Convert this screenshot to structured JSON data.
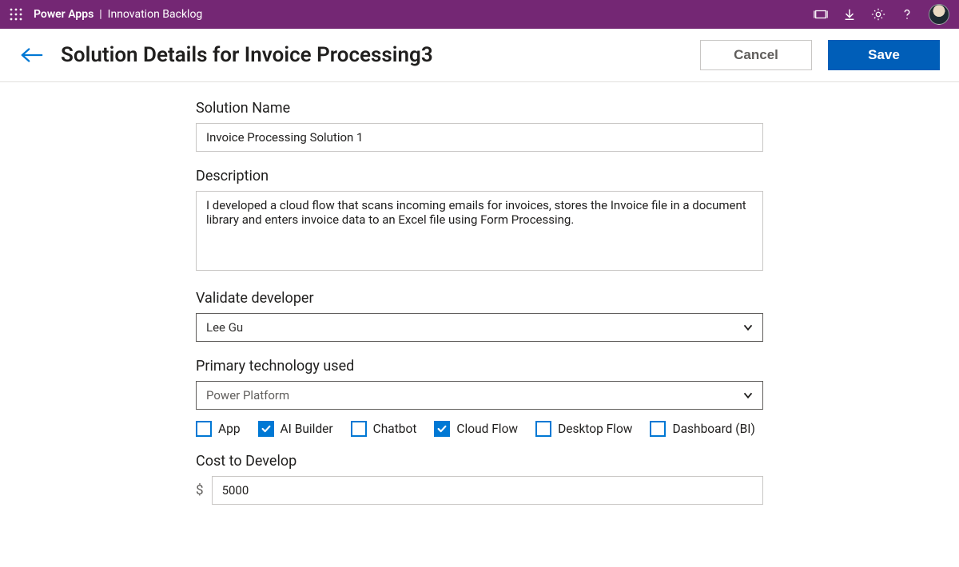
{
  "header": {
    "app_name": "Power Apps",
    "separator": "|",
    "page_name": "Innovation Backlog"
  },
  "page": {
    "title": "Solution Details for Invoice Processing3",
    "cancel_label": "Cancel",
    "save_label": "Save"
  },
  "form": {
    "solution_name": {
      "label": "Solution Name",
      "value": "Invoice Processing Solution 1"
    },
    "description": {
      "label": "Description",
      "value": "I developed a cloud flow that scans incoming emails for invoices, stores the Invoice file in a document library and enters invoice data to an Excel file using Form Processing."
    },
    "validate_developer": {
      "label": "Validate developer",
      "value": "Lee Gu"
    },
    "primary_technology": {
      "label": "Primary technology used",
      "value": "Power Platform"
    },
    "tech_options": [
      {
        "label": "App",
        "checked": false
      },
      {
        "label": "AI Builder",
        "checked": true
      },
      {
        "label": "Chatbot",
        "checked": false
      },
      {
        "label": "Cloud Flow",
        "checked": true
      },
      {
        "label": "Desktop Flow",
        "checked": false
      },
      {
        "label": "Dashboard (BI)",
        "checked": false
      }
    ],
    "cost_to_develop": {
      "label": "Cost to Develop",
      "currency_symbol": "$",
      "value": "5000"
    }
  }
}
